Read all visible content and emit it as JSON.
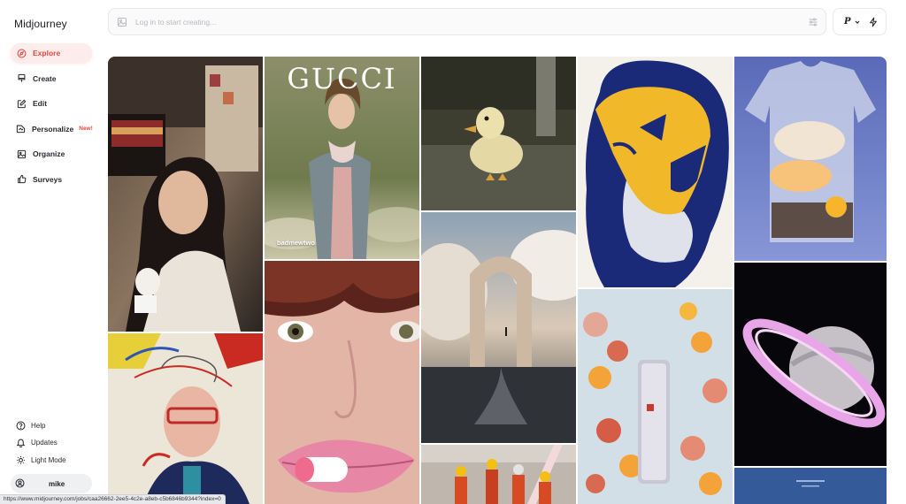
{
  "app": {
    "name": "Midjourney"
  },
  "sidebar": {
    "items": [
      {
        "label": "Explore",
        "icon": "compass-icon",
        "active": true
      },
      {
        "label": "Create",
        "icon": "paintbrush-icon"
      },
      {
        "label": "Edit",
        "icon": "edit-icon"
      },
      {
        "label": "Personalize",
        "icon": "personalize-icon",
        "badge": "New!"
      },
      {
        "label": "Organize",
        "icon": "image-icon"
      },
      {
        "label": "Surveys",
        "icon": "thumbs-up-icon"
      }
    ],
    "bottom": [
      {
        "label": "Help",
        "icon": "help-icon"
      },
      {
        "label": "Updates",
        "icon": "bell-icon"
      },
      {
        "label": "Light Mode",
        "icon": "sun-icon"
      }
    ],
    "user": {
      "name": "mike",
      "icon": "user-icon"
    }
  },
  "search": {
    "placeholder": "Log in to start creating..."
  },
  "top_right": {
    "profile_letter": "P"
  },
  "gallery": {
    "tiles": [
      {
        "name": "tile-girl-with-cup"
      },
      {
        "name": "tile-gucci-portrait",
        "heading": "GUCCI",
        "creator": "badmewtwo"
      },
      {
        "name": "tile-duck"
      },
      {
        "name": "tile-lion"
      },
      {
        "name": "tile-glass-shirt"
      },
      {
        "name": "tile-portrait-collage"
      },
      {
        "name": "tile-pill-lips"
      },
      {
        "name": "tile-cloud-arch"
      },
      {
        "name": "tile-fruit-bottle"
      },
      {
        "name": "tile-saturn"
      },
      {
        "name": "tile-miniature-figures"
      },
      {
        "name": "tile-blue-poster"
      }
    ]
  },
  "status": {
    "url": "https://www.midjourney.com/jobs/caa26662-2ee5-4c2e-a8eb-c5b6846b9344?index=0"
  },
  "colors": {
    "accent": "#e8453c",
    "active_bg": "#fdecec"
  }
}
